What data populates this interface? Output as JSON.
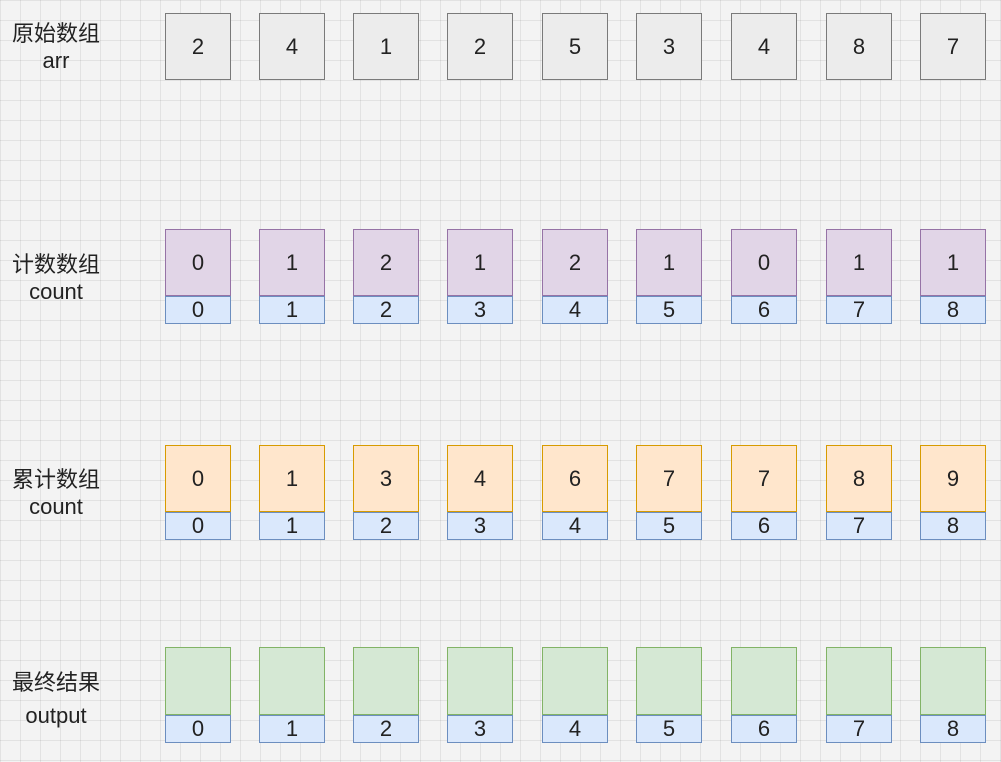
{
  "labels": {
    "arr": [
      "原始数组",
      "arr"
    ],
    "count": [
      "计数数组",
      "count"
    ],
    "cumulative": [
      "累计数组",
      "count"
    ],
    "output": [
      "最终结果",
      "output"
    ]
  },
  "arr": [
    2,
    4,
    1,
    2,
    5,
    3,
    4,
    8,
    7
  ],
  "count": [
    0,
    1,
    2,
    1,
    2,
    1,
    0,
    1,
    1
  ],
  "cumulative": [
    0,
    1,
    3,
    4,
    6,
    7,
    7,
    8,
    9
  ],
  "output": [
    "",
    "",
    "",
    "",
    "",
    "",
    "",
    "",
    ""
  ],
  "indices": [
    0,
    1,
    2,
    3,
    4,
    5,
    6,
    7,
    8
  ],
  "colors": {
    "arr_fill": "#ececec",
    "count_fill": "#e1d5e7",
    "cumulative_fill": "#ffe6cc",
    "output_fill": "#d5e8d4",
    "index_fill": "#dae8fc"
  }
}
